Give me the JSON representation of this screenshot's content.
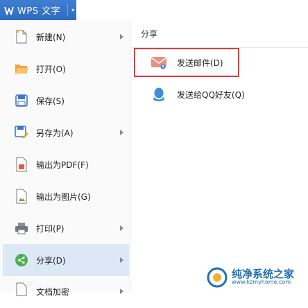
{
  "app": {
    "logo_letter": "W",
    "title": "WPS 文字",
    "brand_color": "#2d6bbf"
  },
  "menu": {
    "items": [
      {
        "label": "新建(N)",
        "icon": "new-file-icon",
        "has_submenu": true
      },
      {
        "label": "打开(O)",
        "icon": "open-folder-icon",
        "has_submenu": false
      },
      {
        "label": "保存(S)",
        "icon": "save-icon",
        "has_submenu": false
      },
      {
        "label": "另存为(A)",
        "icon": "save-as-icon",
        "has_submenu": true
      },
      {
        "label": "输出为PDF(F)",
        "icon": "export-pdf-icon",
        "has_submenu": false
      },
      {
        "label": "输出为图片(G)",
        "icon": "export-image-icon",
        "has_submenu": false
      },
      {
        "label": "打印(P)",
        "icon": "printer-icon",
        "has_submenu": true
      },
      {
        "label": "分享(D)",
        "icon": "share-icon",
        "has_submenu": true,
        "active": true
      },
      {
        "label": "文档加密",
        "icon": "encrypt-icon",
        "has_submenu": true
      }
    ],
    "active_color": "#dce8f6"
  },
  "share_panel": {
    "header": "分享",
    "options": [
      {
        "label": "发送邮件(D)",
        "icon": "mail-icon"
      },
      {
        "label": "发送给QQ好友(Q)",
        "icon": "qq-icon"
      }
    ],
    "highlight_color": "#e03a3a"
  },
  "watermark": {
    "name": "纯净系统之家",
    "url": "www.kzmyhome.com"
  }
}
